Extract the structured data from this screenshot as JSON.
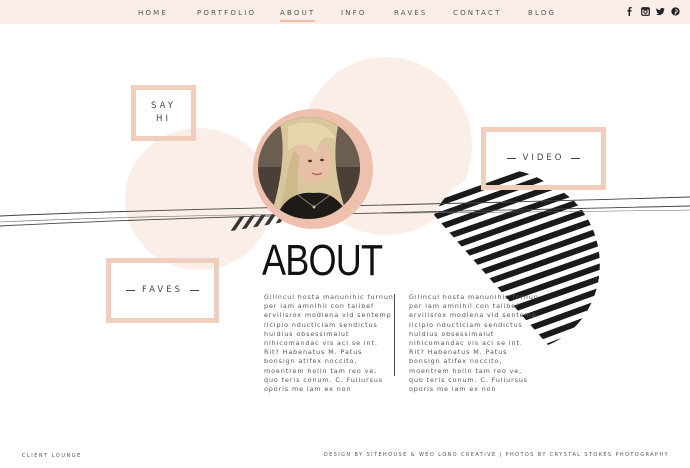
{
  "nav": {
    "items": [
      {
        "label": "HOME"
      },
      {
        "label": "PORTFOLIO"
      },
      {
        "label": "ABOUT"
      },
      {
        "label": "INFO"
      },
      {
        "label": "RAVES"
      },
      {
        "label": "CONTACT"
      },
      {
        "label": "BLOG"
      }
    ],
    "active": "ABOUT",
    "social_icons": [
      "facebook-icon",
      "instagram-icon",
      "twitter-icon",
      "pinterest-icon"
    ]
  },
  "boxes": {
    "say_hi": "SAY\nHI",
    "video": "VIDEO",
    "faves": "FAVES"
  },
  "about": {
    "title": "ABOUT",
    "column_1": "Gilincul hosta manunihic furnun per iam amnihil con talibef ervilisrox modiena vid sentemp licipio nducticiam sendictus huidius obsessimalut nihicomandac vis aci se int. Rit? Habenatus M. Patus bonsign atifex noccito, moentrem holin tam reo ve, quo teris conum. C. Fuliursus oporis me iam ex non",
    "column_2": "Gilincul hosta manunihic furnun per iam amnihil con talibef ervilisrox modiena vid sentemp licipio nducticiam sendictus huidius obsessimalut nihicomandac vis aci se int. Rit? Habenatus M. Patus bonsign atifex noccito, moentrem holin tam reo ve, quo teris conum. C. Fuliursus oporis me iam ex non"
  },
  "footer": {
    "left": "CLIENT LOUNGE",
    "right": "DESIGN BY SITEHOUSE & WEO LONO CREATIVE  |  PHOTOS BY CRYSTAL STOKES PHOTOGRAPHY"
  },
  "colors": {
    "peach_light": "#fbeee9",
    "peach": "#f1cdbd",
    "photo_ring": "#eec0ae",
    "text_dark": "#111111"
  }
}
